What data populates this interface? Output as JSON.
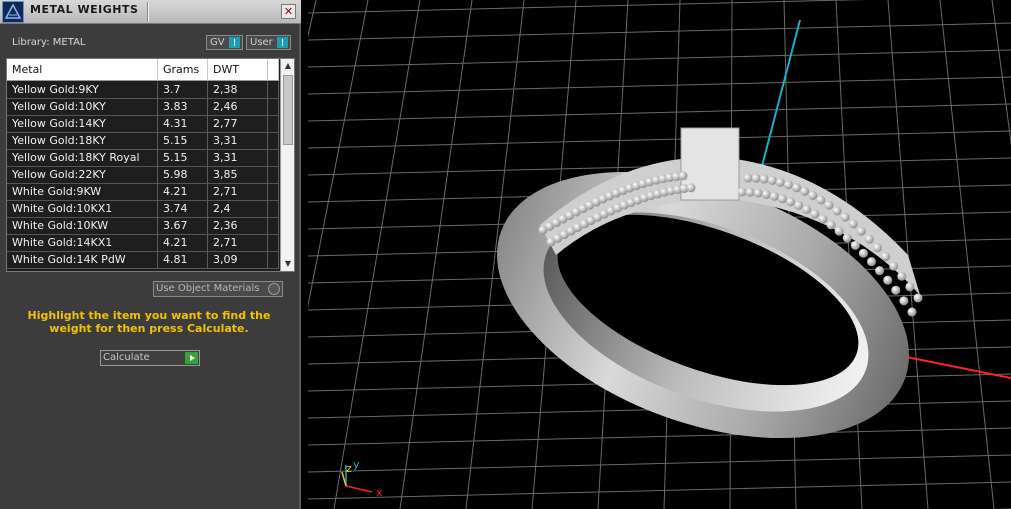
{
  "window": {
    "title": "METAL WEIGHTS",
    "close_glyph": "✕"
  },
  "library": {
    "label": "Library: METAL"
  },
  "toggles": {
    "gv": "GV",
    "user": "User"
  },
  "table": {
    "columns": [
      "Metal",
      "Grams",
      "DWT"
    ],
    "rows": [
      [
        "Yellow Gold:9KY",
        "3.7",
        "2,38"
      ],
      [
        "Yellow Gold:10KY",
        "3.83",
        "2,46"
      ],
      [
        "Yellow Gold:14KY",
        "4.31",
        "2,77"
      ],
      [
        "Yellow Gold:18KY",
        "5.15",
        "3,31"
      ],
      [
        "Yellow Gold:18KY Royal",
        "5.15",
        "3,31"
      ],
      [
        "Yellow Gold:22KY",
        "5.98",
        "3,85"
      ],
      [
        "White Gold:9KW",
        "4.21",
        "2,71"
      ],
      [
        "White Gold:10KX1",
        "3.74",
        "2,4"
      ],
      [
        "White Gold:10KW",
        "3.67",
        "2,36"
      ],
      [
        "White Gold:14KX1",
        "4.21",
        "2,71"
      ],
      [
        "White Gold:14K PdW",
        "4.81",
        "3,09"
      ]
    ]
  },
  "use_object_materials": "Use Object Materials",
  "hint": "Highlight the item you want to find the weight for then press Calculate.",
  "calculate": {
    "label": "Calculate"
  },
  "axes": {
    "z": "z",
    "y": "y",
    "x": "x"
  },
  "colors": {
    "accent": "#16a2b6",
    "hint": "#f3c200",
    "x_axis": "#ff2020",
    "y_axis": "#18b0c8"
  },
  "icons": {
    "app": "rhino-logo-icon",
    "close": "close-icon",
    "go": "play-arrow-icon"
  }
}
